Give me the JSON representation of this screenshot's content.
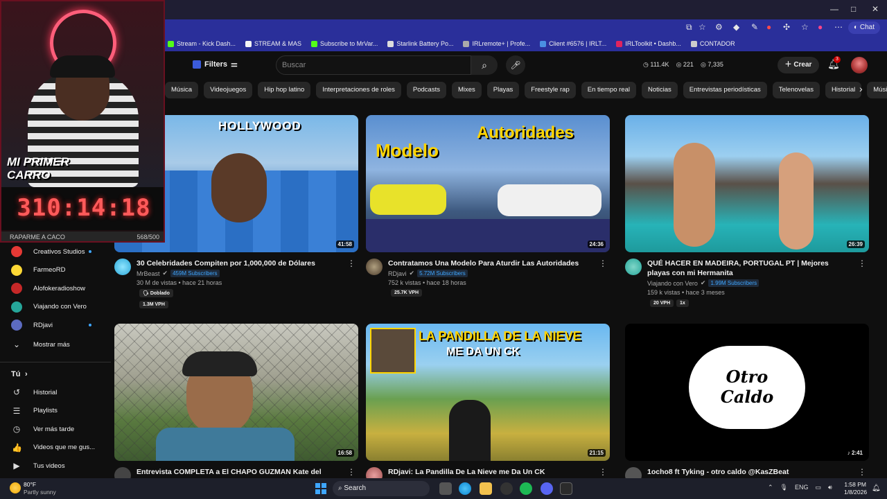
{
  "browser": {
    "window_controls": [
      "—",
      "□",
      "✕"
    ],
    "chat_label": "Chat",
    "bookmarks": [
      {
        "label": "Stream - Kick Dash...",
        "color": "#53fc18"
      },
      {
        "label": "STREAM & MAS",
        "color": "#f5f5f5"
      },
      {
        "label": "Subscribe to MrVar...",
        "color": "#53fc18"
      },
      {
        "label": "Starlink Battery Po...",
        "color": "#dddddd"
      },
      {
        "label": "IRLremote+ | Profe...",
        "color": "#aaaaaa"
      },
      {
        "label": "Client #6576 | IRLT...",
        "color": "#4a90e2"
      },
      {
        "label": "IRLToolkit • Dashb...",
        "color": "#e0245e"
      },
      {
        "label": "CONTADOR",
        "color": "#cccccc"
      }
    ]
  },
  "youtube": {
    "filters_label": "Filters",
    "search_placeholder": "Buscar",
    "stats": [
      "111.4K",
      "221",
      "7,335"
    ],
    "create_label": "Crear",
    "notif_count": "3",
    "chips": [
      "Música",
      "Videojuegos",
      "Hip hop latino",
      "Interpretaciones de roles",
      "Podcasts",
      "Mixes",
      "Playas",
      "Freestyle rap",
      "En tiempo real",
      "Noticias",
      "Entrevistas periodísticas",
      "Telenovelas",
      "Historial",
      "Músic"
    ]
  },
  "overlay": {
    "cam_text": "MI PRIMER CARRO",
    "timer": "310:14:18",
    "goal_label": "RAPARME A CACO",
    "goal_count": "568/500",
    "goal_progress": 1.0
  },
  "sidebar": {
    "subscriptions": [
      {
        "label": "Creativos Studios",
        "color": "#e53935",
        "dot": true
      },
      {
        "label": "FarmeoRD",
        "color": "#fdd835",
        "dot": false
      },
      {
        "label": "Alofokeradioshow",
        "color": "#c62828",
        "dot": false
      },
      {
        "label": "Viajando con Vero",
        "color": "#26a69a",
        "dot": false
      },
      {
        "label": "RDjavi",
        "color": "#5c6bc0",
        "dot": true
      }
    ],
    "show_more": "Mostrar más",
    "you_label": "Tú",
    "you_items": [
      {
        "label": "Historial",
        "icon": "history-icon",
        "glyph": "↺"
      },
      {
        "label": "Playlists",
        "icon": "playlists-icon",
        "glyph": "☰"
      },
      {
        "label": "Ver más tarde",
        "icon": "watch-later-icon",
        "glyph": "◷"
      },
      {
        "label": "Videos que me gus...",
        "icon": "like-icon",
        "glyph": "👍"
      },
      {
        "label": "Tus videos",
        "icon": "your-videos-icon",
        "glyph": "▶"
      }
    ]
  },
  "videos": [
    {
      "title": "30 Celebridades Compiten por 1,000,000 de Dólares",
      "channel": "MrBeast",
      "subs": "459M Subscribers",
      "views": "30 M de vistas • hace 21 horas",
      "duration": "41:58",
      "tags": [
        "Doblado",
        "1.3M VPH"
      ],
      "thumb_text": "HOLLYWOOD"
    },
    {
      "title": "Contratamos Una Modelo Para Aturdir Las Autoridades",
      "channel": "RDjavi",
      "subs": "5.72M Subscribers",
      "views": "752 k vistas • hace 18 horas",
      "duration": "24:36",
      "tags": [
        "25.7K VPH"
      ],
      "thumb_text_1": "Modelo",
      "thumb_text_2": "Autoridades"
    },
    {
      "title": "QUÉ HACER EN MADEIRA, PORTUGAL PT | Mejores playas con mi Hermanita",
      "channel": "Viajando con Vero",
      "subs": "1.99M Subscribers",
      "views": "159 k vistas • hace 3 meses",
      "duration": "26:39",
      "tags": [
        "20 VPH",
        "1x"
      ]
    },
    {
      "title": "Entrevista COMPLETA a El CHAPO GUZMAN Kate del Castillo y",
      "duration": "16:58"
    },
    {
      "title": "RDjavi: La Pandilla De La Nieve me Da Un CK",
      "duration": "21:15",
      "thumb_text_1": "LA PANDILLA DE LA NIEVE",
      "thumb_text_2": "ME DA UN CK"
    },
    {
      "title": "1ocho8 ft Tyking - otro caldo @KasZBeat",
      "duration": "♪ 2:41",
      "thumb_text": "Otro Caldo"
    }
  ],
  "taskbar": {
    "temp": "80°F",
    "weather": "Partly sunny",
    "search_label": "Search",
    "lang": "ENG",
    "time": "1:58 PM",
    "date": "1/8/2026"
  }
}
